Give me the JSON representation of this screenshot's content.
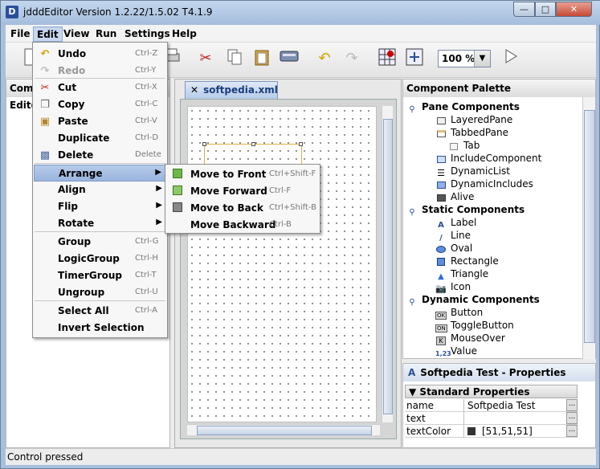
{
  "window": {
    "title": "jdddEditor Version 1.2.22/1.5.02 T4.1.9",
    "controls": {
      "minimize": "—",
      "maximize": "□",
      "close": "✕"
    }
  },
  "menubar": [
    "File",
    "Edit",
    "View",
    "Run",
    "Settings",
    "Help"
  ],
  "toolbar": {
    "icons": [
      "new-icon",
      "print-icon",
      "cut-icon",
      "copy-icon",
      "paste-icon",
      "delete-icon",
      "undo-icon",
      "redo-icon",
      "grid-icon",
      "snap-icon",
      "run-icon"
    ],
    "zoom": "100 %"
  },
  "left_panel": {
    "header": "Comp",
    "subheader": "Edito"
  },
  "document_tab": {
    "close": "✕",
    "label": "softpedia.xml"
  },
  "edit_menu": [
    {
      "label": "Undo",
      "shortcut": "Ctrl-Z",
      "icon": "undo-icon",
      "enabled": true
    },
    {
      "label": "Redo",
      "shortcut": "Ctrl-Y",
      "icon": "redo-icon",
      "enabled": false
    },
    {
      "label": "Cut",
      "shortcut": "Ctrl-X",
      "icon": "cut-icon",
      "enabled": true
    },
    {
      "label": "Copy",
      "shortcut": "Ctrl-C",
      "icon": "copy-icon",
      "enabled": true
    },
    {
      "label": "Paste",
      "shortcut": "Ctrl-V",
      "icon": "paste-icon",
      "enabled": true
    },
    {
      "label": "Duplicate",
      "shortcut": "Ctrl-D",
      "icon": "",
      "enabled": true
    },
    {
      "label": "Delete",
      "shortcut": "Delete",
      "icon": "delete-icon",
      "enabled": true
    },
    {
      "label": "Arrange",
      "submenu": true,
      "highlighted": true
    },
    {
      "label": "Align",
      "submenu": true
    },
    {
      "label": "Flip",
      "submenu": true
    },
    {
      "label": "Rotate",
      "submenu": true
    },
    {
      "label": "Group",
      "shortcut": "Ctrl-G"
    },
    {
      "label": "LogicGroup",
      "shortcut": "Ctrl-H"
    },
    {
      "label": "TimerGroup",
      "shortcut": "Ctrl-T"
    },
    {
      "label": "Ungroup",
      "shortcut": "Ctrl-U"
    },
    {
      "label": "Select All",
      "shortcut": "Ctrl-A"
    },
    {
      "label": "Invert Selection",
      "shortcut": ""
    }
  ],
  "arrange_menu": [
    {
      "label": "Move to Front",
      "shortcut": "Ctrl+Shift-F"
    },
    {
      "label": "Move Forward",
      "shortcut": "Ctrl-F"
    },
    {
      "label": "Move to Back",
      "shortcut": "Ctrl+Shift-B"
    },
    {
      "label": "Move Backward",
      "shortcut": "Ctrl-B"
    }
  ],
  "palette": {
    "header": "Component Palette",
    "items": [
      {
        "label": "Pane Components",
        "group": true,
        "icon": "expand-key-icon"
      },
      {
        "label": "LayeredPane",
        "icon": "layered-pane-icon"
      },
      {
        "label": "TabbedPane",
        "icon": "tabbed-pane-icon"
      },
      {
        "label": "Tab",
        "icon": "tab-icon"
      },
      {
        "label": "IncludeComponent",
        "icon": "include-icon"
      },
      {
        "label": "DynamicList",
        "icon": "list-icon"
      },
      {
        "label": "DynamicIncludes",
        "icon": "dynamic-includes-icon"
      },
      {
        "label": "Alive",
        "icon": "alive-icon"
      },
      {
        "label": "Static Components",
        "group": true,
        "icon": "expand-key-icon"
      },
      {
        "label": "Label",
        "icon": "label-icon"
      },
      {
        "label": "Line",
        "icon": "line-icon"
      },
      {
        "label": "Oval",
        "icon": "oval-icon"
      },
      {
        "label": "Rectangle",
        "icon": "rectangle-icon"
      },
      {
        "label": "Triangle",
        "icon": "triangle-icon"
      },
      {
        "label": "Icon",
        "icon": "image-icon"
      },
      {
        "label": "Dynamic Components",
        "group": true,
        "icon": "expand-key-icon"
      },
      {
        "label": "Button",
        "icon": "button-icon"
      },
      {
        "label": "ToggleButton",
        "icon": "toggle-button-icon"
      },
      {
        "label": "MouseOver",
        "icon": "mouseover-icon"
      },
      {
        "label": "Value",
        "icon": "value-icon"
      }
    ]
  },
  "properties": {
    "header": "Softpedia Test - Properties",
    "section": "Standard Properties",
    "rows": [
      {
        "name": "name",
        "value": "Softpedia Test"
      },
      {
        "name": "text",
        "value": ""
      },
      {
        "name": "textColor",
        "value": "[51,51,51]",
        "color": "#333333"
      }
    ]
  },
  "status": "Control pressed"
}
